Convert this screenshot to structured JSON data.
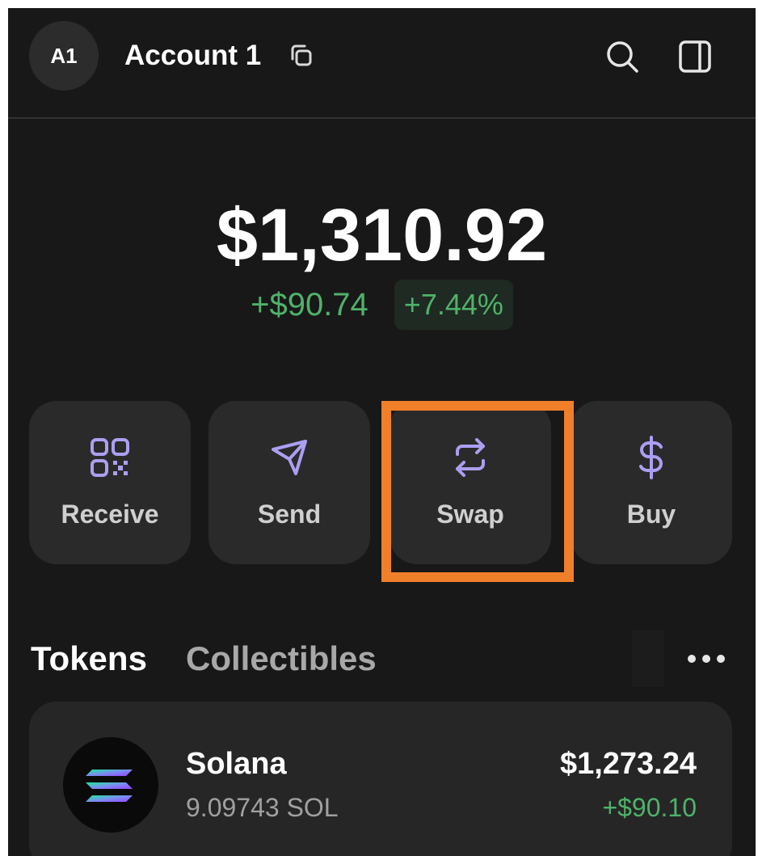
{
  "header": {
    "avatar_initials": "A1",
    "account_name": "Account 1",
    "icons": [
      "copy-icon",
      "search-icon",
      "sidebar-icon"
    ]
  },
  "portfolio": {
    "balance": "$1,310.92",
    "change_amount": "+$90.74",
    "change_percent": "+7.44%"
  },
  "actions": [
    {
      "label": "Receive",
      "icon": "qr-code-icon"
    },
    {
      "label": "Send",
      "icon": "send-icon"
    },
    {
      "label": "Swap",
      "icon": "swap-icon"
    },
    {
      "label": "Buy",
      "icon": "dollar-icon"
    }
  ],
  "tabs": [
    {
      "label": "Tokens",
      "active": true
    },
    {
      "label": "Collectibles",
      "active": false
    }
  ],
  "tokens": [
    {
      "name": "Solana",
      "balance": "9.09743 SOL",
      "value": "$1,273.24",
      "change": "+$90.10"
    }
  ],
  "colors": {
    "background": "#181818",
    "card": "#2a2a2a",
    "accent": "#ab9ff2",
    "positive": "#4fb26a",
    "highlight": "#f07f2a"
  }
}
